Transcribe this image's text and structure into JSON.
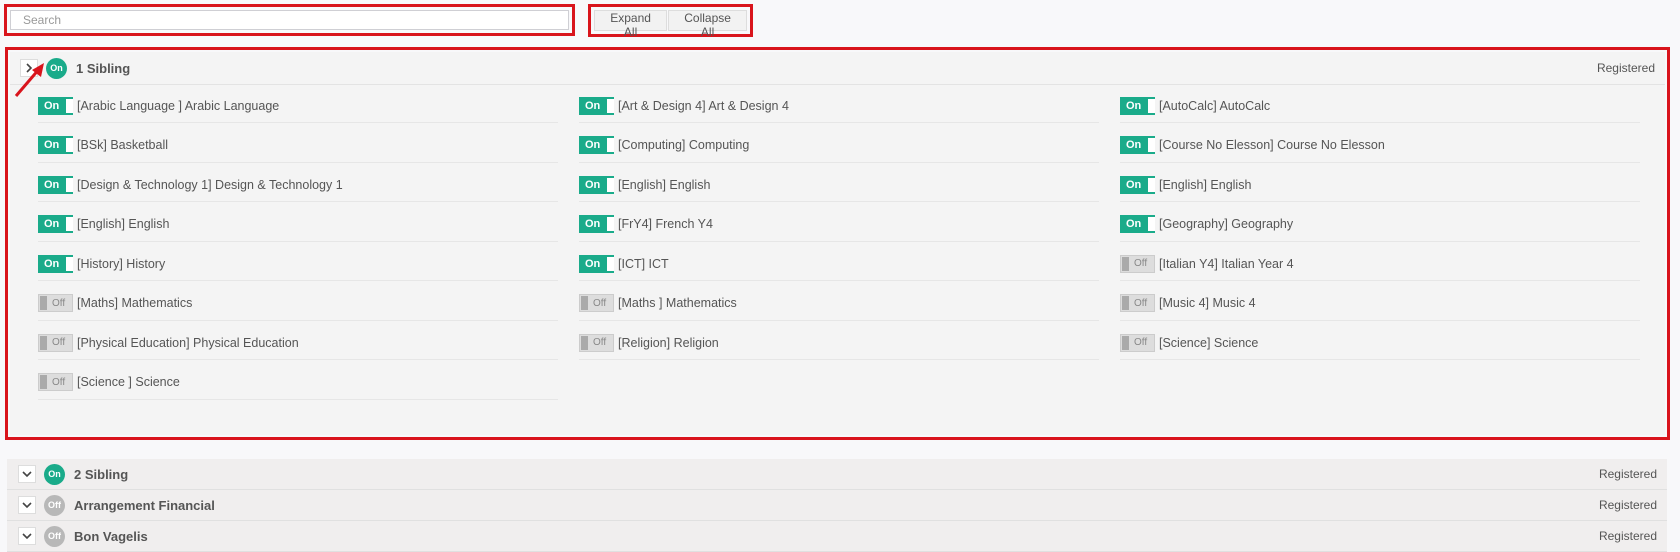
{
  "search": {
    "placeholder": "Search",
    "value": ""
  },
  "toolbar": {
    "expand_all": "Expand All",
    "collapse_all": "Collapse All"
  },
  "expanded_group": {
    "name": "1 Sibling",
    "badge": "On",
    "status": "Registered",
    "courses": [
      {
        "toggle": "On",
        "label": "[Arabic Language ] Arabic Language"
      },
      {
        "toggle": "On",
        "label": "[Art & Design 4] Art & Design 4"
      },
      {
        "toggle": "On",
        "label": "[AutoCalc] AutoCalc"
      },
      {
        "toggle": "On",
        "label": "[BSk] Basketball"
      },
      {
        "toggle": "On",
        "label": "[Computing] Computing"
      },
      {
        "toggle": "On",
        "label": "[Course No Elesson] Course No Elesson"
      },
      {
        "toggle": "On",
        "label": "[Design & Technology 1] Design & Technology 1"
      },
      {
        "toggle": "On",
        "label": "[English] English"
      },
      {
        "toggle": "On",
        "label": "[English] English"
      },
      {
        "toggle": "On",
        "label": "[English] English"
      },
      {
        "toggle": "On",
        "label": "[FrY4] French Y4"
      },
      {
        "toggle": "On",
        "label": "[Geography] Geography"
      },
      {
        "toggle": "On",
        "label": "[History] History"
      },
      {
        "toggle": "On",
        "label": "[ICT] ICT"
      },
      {
        "toggle": "Off",
        "label": "[Italian Y4] Italian Year 4"
      },
      {
        "toggle": "Off",
        "label": "[Maths] Mathematics"
      },
      {
        "toggle": "Off",
        "label": "[Maths ] Mathematics"
      },
      {
        "toggle": "Off",
        "label": "[Music 4] Music 4"
      },
      {
        "toggle": "Off",
        "label": "[Physical Education] Physical Education"
      },
      {
        "toggle": "Off",
        "label": "[Religion] Religion"
      },
      {
        "toggle": "Off",
        "label": "[Science] Science"
      },
      {
        "toggle": "Off",
        "label": "[Science ] Science"
      }
    ]
  },
  "collapsed_groups": [
    {
      "name": "2 Sibling",
      "badge": "On",
      "status": "Registered"
    },
    {
      "name": "Arrangement Financial",
      "badge": "Off",
      "status": "Registered"
    },
    {
      "name": "Bon Vagelis",
      "badge": "Off",
      "status": "Registered"
    }
  ],
  "colors": {
    "on": "#1aab8a",
    "off": "#b8b8b8",
    "highlight": "#d9141c"
  }
}
